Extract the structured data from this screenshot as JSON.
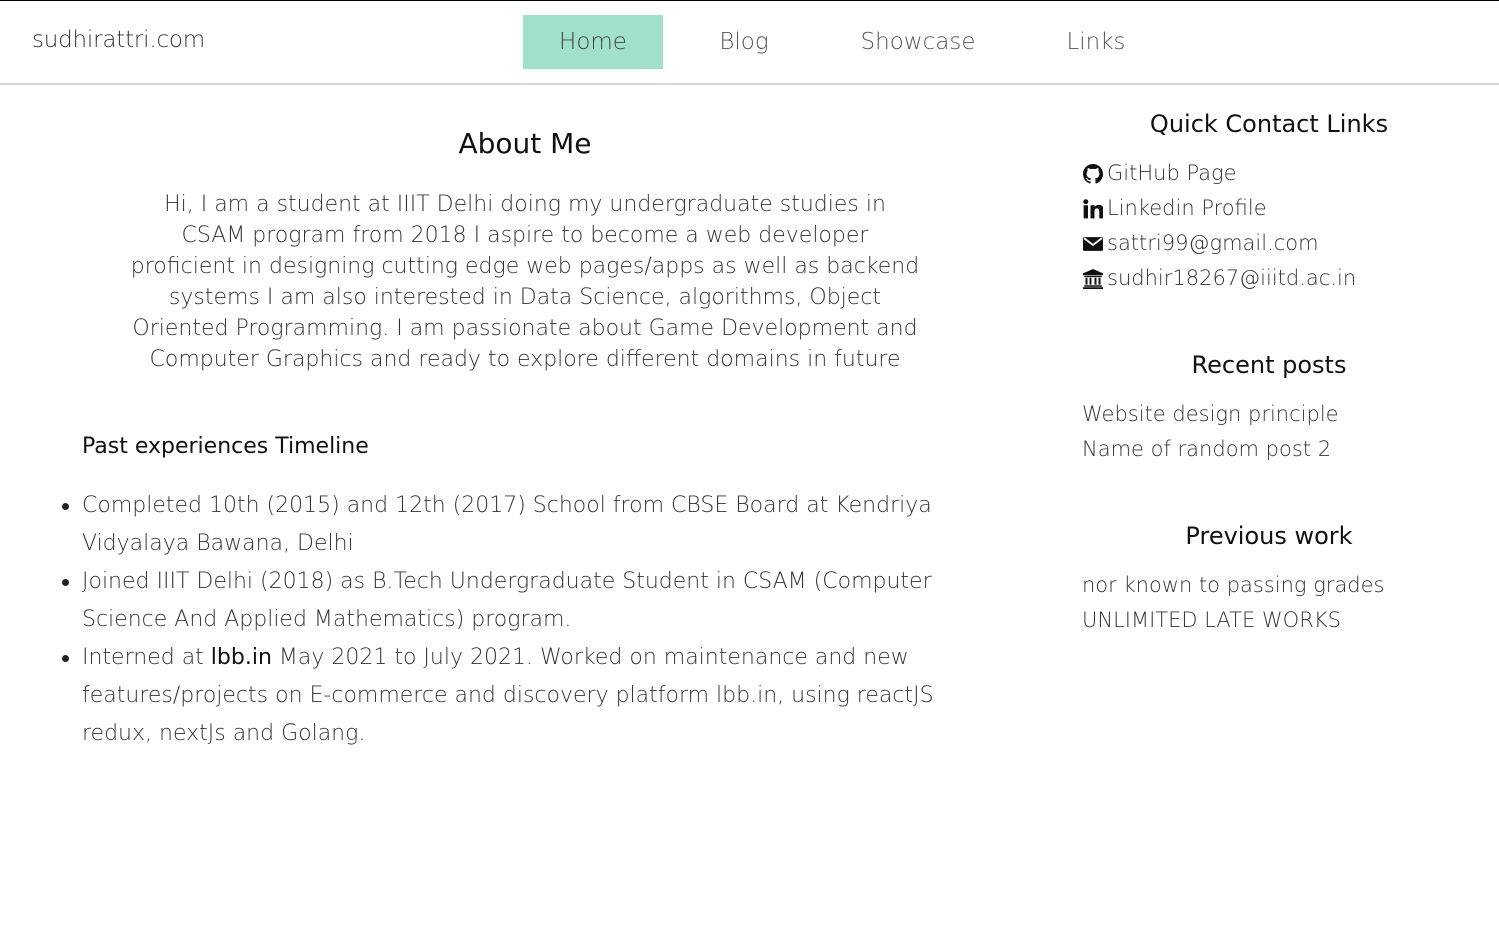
{
  "nav": {
    "brand": "sudhirattri.com",
    "items": [
      {
        "label": "Home",
        "active": true
      },
      {
        "label": "Blog"
      },
      {
        "label": "Showcase"
      },
      {
        "label": "Links"
      }
    ],
    "active_color": "#a1e1c9"
  },
  "about": {
    "title": "About Me",
    "text": "Hi, I am a student at IIIT Delhi doing my undergraduate studies in CSAM program from 2018 I aspire to become a web developer proficient in designing cutting edge web pages/apps as well as backend systems I am also interested in Data Science, algorithms, Object Oriented Programming. I am passionate about Game Development and Computer Graphics and ready to explore different domains in future"
  },
  "timeline": {
    "title": "Past experiences Timeline",
    "items": [
      {
        "text": "Completed 10th (2015) and 12th (2017) School from CBSE Board at Kendriya Vidyalaya Bawana, Delhi"
      },
      {
        "text": "Joined IIIT Delhi (2018) as B.Tech Undergraduate Student in CSAM (Computer Science And Applied Mathematics) program."
      },
      {
        "prefix": "Interned at ",
        "link": "lbb.in",
        "suffix": " May 2021 to July 2021. Worked on maintenance and new features/projects on E-commerce and discovery platform lbb.in, using reactJS redux, nextJs and Golang."
      }
    ]
  },
  "sidebar": {
    "contact": {
      "title": "Quick Contact Links",
      "links": [
        {
          "icon": "github-icon",
          "label": "GitHub Page"
        },
        {
          "icon": "linkedin-icon",
          "label": "Linkedin Profile"
        },
        {
          "icon": "envelope-icon",
          "label": "sattri99@gmail.com"
        },
        {
          "icon": "university-icon",
          "label": "sudhir18267@iiitd.ac.in"
        }
      ]
    },
    "posts": {
      "title": "Recent posts",
      "items": [
        "Website design principle",
        "Name of random post 2"
      ]
    },
    "work": {
      "title": "Previous work",
      "items": [
        "nor known to passing grades",
        "UNLIMITED LATE WORKS"
      ]
    }
  }
}
